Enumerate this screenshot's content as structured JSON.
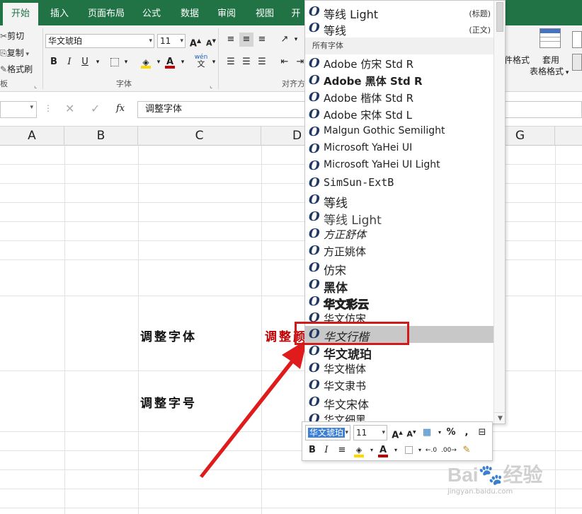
{
  "ribbon_tabs": [
    "开始",
    "插入",
    "页面布局",
    "公式",
    "数据",
    "审阅",
    "视图",
    "开"
  ],
  "clipboard": {
    "cut": "剪切",
    "copy": "复制",
    "format_painter": "格式刷",
    "label": "板"
  },
  "font_group": {
    "font_name": "华文琥珀",
    "font_size": "11",
    "label": "字体",
    "bold": "B",
    "italic": "I",
    "underline": "U",
    "grow": "A",
    "shrink": "A",
    "phonetic_top": "wén",
    "phonetic_bottom": "文"
  },
  "align_group": {
    "label": "对齐方"
  },
  "styles_group": {
    "cond_format": "件格式",
    "table_format_top": "套用",
    "table_format_bottom": "表格格式"
  },
  "formula_bar": {
    "content": "调整字体",
    "fx": "fx"
  },
  "columns": [
    "A",
    "B",
    "C",
    "D",
    "G"
  ],
  "cells": {
    "c_row1": "调整字体",
    "d_row1": "调整",
    "d_row1_tail": "颜",
    "c_row2": "调整字号"
  },
  "font_dropdown": {
    "theme_fonts": [
      {
        "name": "等线 Light",
        "tag": "(标题)"
      },
      {
        "name": "等线",
        "tag": "(正文)"
      }
    ],
    "section_label": "所有字体",
    "fonts": [
      "Adobe 仿宋 Std R",
      "Adobe 黑体 Std R",
      "Adobe 楷体 Std R",
      "Adobe 宋体 Std L",
      "Malgun Gothic Semilight",
      "Microsoft YaHei UI",
      "Microsoft YaHei UI Light",
      "SimSun-ExtB",
      "等线",
      "等线 Light",
      "方正舒体",
      "方正姚体",
      "仿宋",
      "黑体",
      "华文彩云",
      "华文仿宋",
      "华文行楷",
      "华文琥珀",
      "华文楷体",
      "华文隶书",
      "华文宋体",
      "华文细黑"
    ],
    "selected": "华文行楷",
    "icon_glyph": "O"
  },
  "mini_toolbar": {
    "font_name": "华文琥珀",
    "font_size": "11",
    "percent": "%",
    "comma": ","
  },
  "watermark": {
    "brand": "Bai",
    "brand_cn": "经验",
    "url": "jingyan.baidu.com"
  },
  "colors": {
    "excel_green": "#217346",
    "highlight_red": "#d11a1a",
    "font_red": "#c00000",
    "highlight_yellow": "#ffd800"
  }
}
